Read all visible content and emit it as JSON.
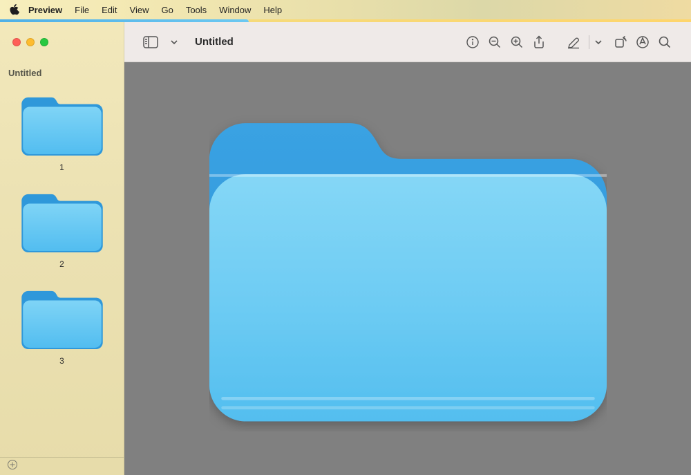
{
  "menubar": {
    "app_name": "Preview",
    "items": [
      "File",
      "Edit",
      "View",
      "Go",
      "Tools",
      "Window",
      "Help"
    ]
  },
  "window": {
    "title": "Untitled"
  },
  "sidebar": {
    "doc_title": "Untitled",
    "thumbs": [
      {
        "label": "1"
      },
      {
        "label": "2"
      },
      {
        "label": "3"
      }
    ]
  },
  "toolbar": {
    "view_menu_icon": "sidebar-layout-icon",
    "title": "Untitled",
    "buttons": [
      {
        "name": "info-icon"
      },
      {
        "name": "zoom-out-icon"
      },
      {
        "name": "zoom-in-icon"
      },
      {
        "name": "share-icon"
      },
      {
        "name": "highlight-icon"
      },
      {
        "name": "chevron-down-icon"
      },
      {
        "name": "rotate-icon"
      },
      {
        "name": "markup-icon"
      },
      {
        "name": "search-icon"
      }
    ]
  },
  "colors": {
    "folder_back": "#2f98da",
    "folder_front_top": "#7ed3f5",
    "folder_front_bot": "#59bff0",
    "canvas_bg": "#808080"
  }
}
